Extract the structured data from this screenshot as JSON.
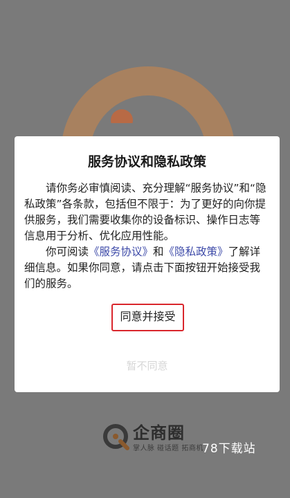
{
  "dialog": {
    "title": "服务协议和隐私政策",
    "para1": "请你务必审慎阅读、充分理解“服务协议”和“隐私政策”各条款，包括但不限于：为了更好的向你提供服务，我们需要收集你的设备标识、操作日志等信息用于分析、优化应用性能。",
    "para2_prefix": "你可阅读",
    "service_link": "《服务协议》",
    "para2_and": "和",
    "privacy_link": "《隐私政策》",
    "para2_suffix": "了解详细信息。如果你同意，请点击下面按钮开始接受我们的服务。",
    "agree_label": "同意并接受",
    "decline_label": "暂不同意"
  },
  "brand": {
    "name": "企商圈",
    "slogan": "掌人脉 碰话题 拓商机"
  },
  "watermark": "78下载站",
  "colors": {
    "link": "#3d4aa8",
    "agree_border": "#d9262c",
    "overlay": "#7a7a7a"
  }
}
